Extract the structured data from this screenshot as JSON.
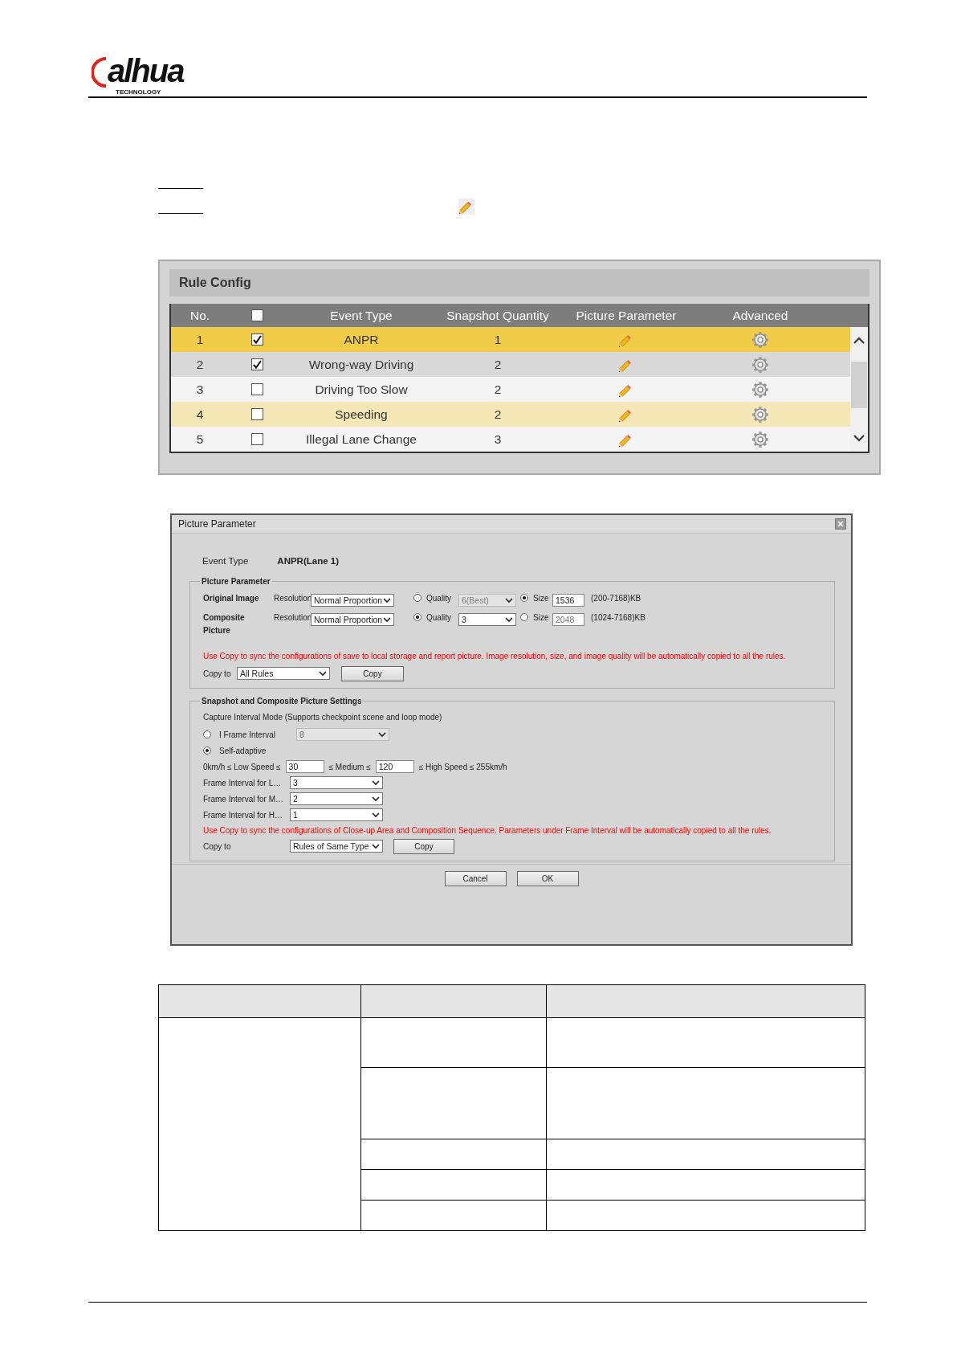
{
  "header": {
    "logo": "alhua",
    "logo_tagline": "TECHNOLOGY"
  },
  "rule_config": {
    "title": "Rule Config",
    "columns": [
      "No.",
      "Event Type",
      "Snapshot Quantity",
      "Picture Parameter",
      "Advanced"
    ],
    "header_checked": false,
    "rows": [
      {
        "no": "1",
        "checked": true,
        "event_type": "ANPR",
        "snapshot_quantity": "1",
        "selected": true,
        "hovered": false
      },
      {
        "no": "2",
        "checked": true,
        "event_type": "Wrong-way Driving",
        "snapshot_quantity": "2",
        "selected": false,
        "hovered": false
      },
      {
        "no": "3",
        "checked": false,
        "event_type": "Driving Too Slow",
        "snapshot_quantity": "2",
        "selected": false,
        "hovered": false
      },
      {
        "no": "4",
        "checked": false,
        "event_type": "Speeding",
        "snapshot_quantity": "2",
        "selected": false,
        "hovered": true
      },
      {
        "no": "5",
        "checked": false,
        "event_type": "Illegal Lane Change",
        "snapshot_quantity": "3",
        "selected": false,
        "hovered": false
      }
    ]
  },
  "dialog": {
    "title": "Picture Parameter",
    "event_type_label": "Event Type",
    "event_type_value": "ANPR(Lane 1)",
    "picture_parameter": {
      "legend": "Picture Parameter",
      "rows": [
        {
          "label": "Original Image",
          "resolution_label": "Resolution",
          "resolution": "Normal Proportion",
          "quality_label": "Quality",
          "quality": "6(Best)",
          "quality_selected": false,
          "size_label": "Size",
          "size": "1536",
          "size_selected": true,
          "range": "(200-7168)KB"
        },
        {
          "label": "Composite Picture",
          "resolution_label": "Resolution",
          "resolution": "Normal Proportion",
          "quality_label": "Quality",
          "quality": "3",
          "quality_selected": true,
          "size_label": "Size",
          "size": "2048",
          "size_selected": false,
          "range": "(1024-7168)KB"
        }
      ],
      "note": "Use Copy to sync the configurations of save to local storage and report picture. Image resolution, size, and image quality will be automatically copied to all the rules.",
      "copy_to_label": "Copy to",
      "copy_to": "All Rules",
      "copy_button": "Copy"
    },
    "snapshot_settings": {
      "legend": "Snapshot and Composite Picture Settings",
      "mode_label": "Capture Interval Mode (Supports checkpoint scene and loop mode)",
      "modes": [
        {
          "label": "I Frame Interval",
          "selected": false,
          "value": "8"
        },
        {
          "label": "Self-adaptive",
          "selected": true
        }
      ],
      "speed_low_label": "0km/h ≤ Low Speed ≤",
      "speed_low": "30",
      "speed_medium_label": "≤ Medium ≤",
      "speed_medium": "120",
      "speed_high_label": "≤ High Speed ≤ 255km/h",
      "frame_intervals": [
        {
          "label": "Frame Interval for L…",
          "value": "3"
        },
        {
          "label": "Frame Interval for M…",
          "value": "2"
        },
        {
          "label": "Frame Interval for H…",
          "value": "1"
        }
      ],
      "note": "Use Copy to sync the configurations of Close-up Area and Composition Sequence. Parameters under Frame Interval will be automatically copied to all the rules.",
      "copy_to_label": "Copy to",
      "copy_to": "Rules of Same Type",
      "copy_button": "Copy"
    },
    "buttons": [
      "Cancel",
      "OK"
    ]
  }
}
